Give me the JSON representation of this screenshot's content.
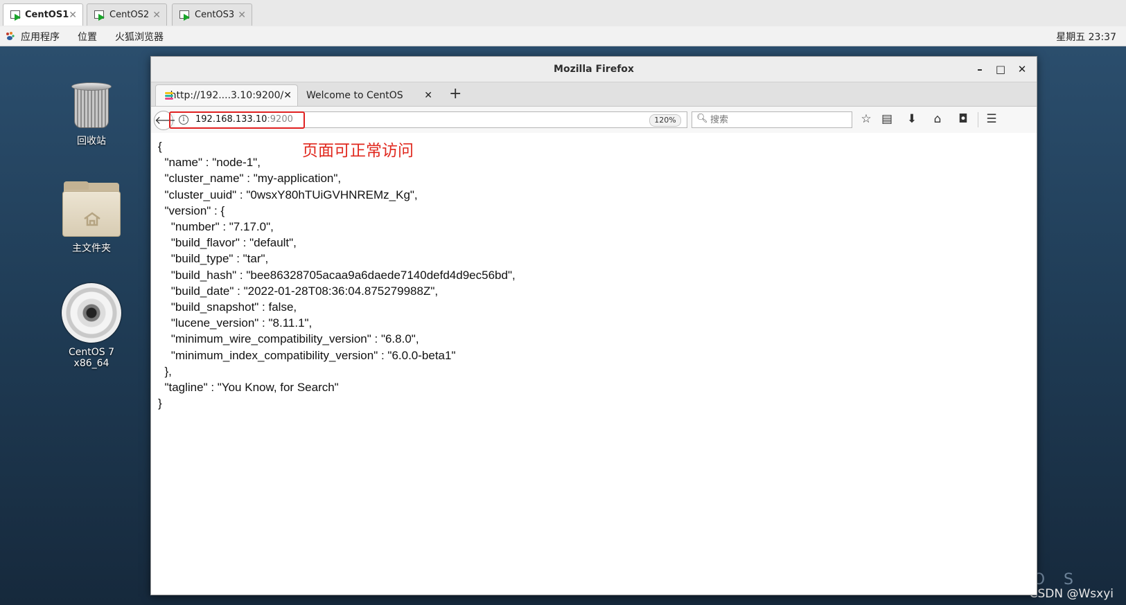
{
  "vm_tabs": [
    {
      "label": "CentOS1",
      "active": true
    },
    {
      "label": "CentOS2",
      "active": false
    },
    {
      "label": "CentOS3",
      "active": false
    }
  ],
  "top_bar": {
    "menus": [
      "应用程序",
      "位置",
      "火狐浏览器"
    ],
    "clock": "星期五 23:37"
  },
  "desktop": {
    "icons": [
      {
        "label": "回收站",
        "icon": "trash-icon"
      },
      {
        "label": "主文件夹",
        "icon": "home-folder-icon"
      },
      {
        "label": "CentOS 7 x86_64",
        "icon": "disc-icon"
      }
    ],
    "watermark": "CSDN @Wsxyi",
    "background_text": "O S"
  },
  "firefox": {
    "title": "Mozilla Firefox",
    "tabs": [
      {
        "label": "http://192....3.10:9200/",
        "active": true
      },
      {
        "label": "Welcome to CentOS",
        "active": false
      }
    ],
    "url": {
      "host": "192.168.133.10",
      "port": ":9200"
    },
    "zoom": "120%",
    "search_placeholder": "搜索"
  },
  "annotation": {
    "text": "页面可正常访问",
    "color": "#e0281e"
  },
  "content": {
    "json_text": "{\n  \"name\" : \"node-1\",\n  \"cluster_name\" : \"my-application\",\n  \"cluster_uuid\" : \"0wsxY80hTUiGVHNREMz_Kg\",\n  \"version\" : {\n    \"number\" : \"7.17.0\",\n    \"build_flavor\" : \"default\",\n    \"build_type\" : \"tar\",\n    \"build_hash\" : \"bee86328705acaa9a6daede7140defd4d9ec56bd\",\n    \"build_date\" : \"2022-01-28T08:36:04.875279988Z\",\n    \"build_snapshot\" : false,\n    \"lucene_version\" : \"8.11.1\",\n    \"minimum_wire_compatibility_version\" : \"6.8.0\",\n    \"minimum_index_compatibility_version\" : \"6.0.0-beta1\"\n  },\n  \"tagline\" : \"You Know, for Search\"\n}"
  },
  "colors": {
    "accent_red": "#e02020",
    "desktop_bg": "#203d57"
  }
}
